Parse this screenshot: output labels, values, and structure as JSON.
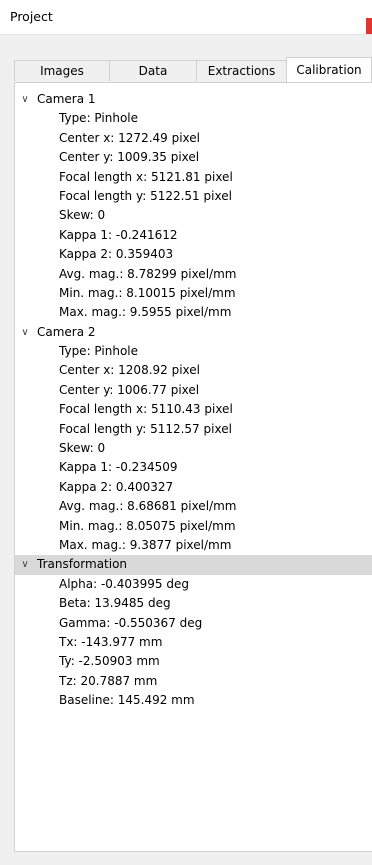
{
  "window": {
    "title": "Project"
  },
  "tabs": [
    {
      "label": "Images"
    },
    {
      "label": "Data"
    },
    {
      "label": "Extractions"
    },
    {
      "label": "Calibration"
    }
  ],
  "tree": {
    "camera1": {
      "label": "Camera 1",
      "items": [
        "Type: Pinhole",
        "Center x: 1272.49 pixel",
        "Center y: 1009.35 pixel",
        "Focal length x: 5121.81 pixel",
        "Focal length y: 5122.51 pixel",
        "Skew: 0",
        "Kappa 1: -0.241612",
        "Kappa 2: 0.359403",
        "Avg. mag.: 8.78299 pixel/mm",
        "Min. mag.: 8.10015 pixel/mm",
        "Max. mag.: 9.5955 pixel/mm"
      ]
    },
    "camera2": {
      "label": "Camera 2",
      "items": [
        "Type: Pinhole",
        "Center x: 1208.92 pixel",
        "Center y: 1006.77 pixel",
        "Focal length x: 5110.43 pixel",
        "Focal length y: 5112.57 pixel",
        "Skew: 0",
        "Kappa 1: -0.234509",
        "Kappa 2: 0.400327",
        "Avg. mag.: 8.68681 pixel/mm",
        "Min. mag.: 8.05075 pixel/mm",
        "Max. mag.: 9.3877 pixel/mm"
      ]
    },
    "transformation": {
      "label": "Transformation",
      "items": [
        "Alpha: -0.403995 deg",
        "Beta: 13.9485 deg",
        "Gamma: -0.550367 deg",
        "Tx: -143.977 mm",
        "Ty: -2.50903 mm",
        "Tz: 20.7887 mm",
        "Baseline: 145.492 mm"
      ]
    }
  }
}
